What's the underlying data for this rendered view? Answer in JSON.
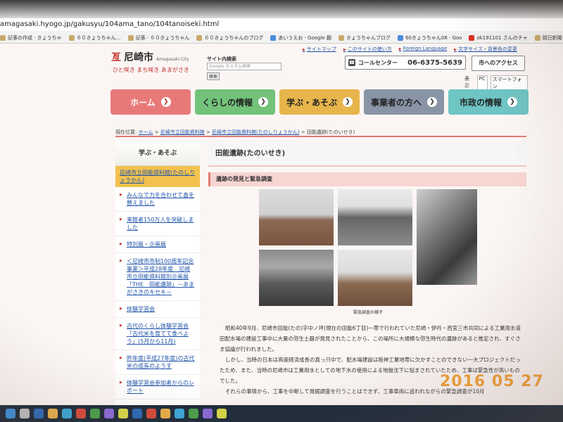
{
  "browser": {
    "url": "amagasaki.hyogo.jp/gakusyu/104ama_tano/104tanoiseki.html",
    "bookmarks": [
      "記事の作成 · きょうちゃ",
      "６０きょうちゃん…",
      "記事 · ６０きょうちゃん",
      "６０きょうちゃんのブログ",
      "あいうえお · Google 翻",
      "きょうちゃんブログ",
      "60きょうちゃん06 · Goo",
      "ok191101 さんのチャ",
      "顔日新聞デジタル"
    ]
  },
  "site": {
    "logo_mark": "亙",
    "logo_name": "尼崎市",
    "logo_en": "Amagasaki City",
    "tagline": "ひと咲き まち咲き あまがさき",
    "search_label": "サイト内検索",
    "search_placeholder": "Google カスタム検索",
    "search_button": "検索",
    "top_links": [
      "サイトマップ",
      "このサイトの使い方",
      "Foreign Language",
      "文字サイズ・背景色の変更"
    ],
    "call_center_label": "コールセンター",
    "call_center_number": "06-6375-5639",
    "access_button": "市へのアクセス",
    "display_label": "表示",
    "display_options": [
      "PC",
      "スマートフォン"
    ]
  },
  "nav": {
    "home": "ホーム",
    "life": "くらしの情報",
    "learn": "学ぶ・あそぶ",
    "business": "事業者の方へ",
    "city": "市政の情報"
  },
  "breadcrumb": {
    "prefix": "現在位置:",
    "items": [
      "ホーム",
      "尼崎市立田能資料館",
      "尼崎市立田能資料館(たのしりょうかん)",
      "田能遺跡(たのいせき)"
    ]
  },
  "sidebar": {
    "heading": "学ぶ・あそぶ",
    "current": "尼崎市立田能資料館(たのしりょうかん)",
    "items": [
      "みんなで力を合わせて畠を替えました",
      "来館者150万人を突破しました",
      "特別展・企画展",
      "＜尼崎市市制100周年記念事業＞平成28年度　尼崎市立田能資料館別企画展「THE　田能遺跡」－あまがさきのキセキ－",
      "体験学習会",
      "古代のくらし体験学習会「古代米を育てて食べよう」(5月から11月)",
      "昨年度(平成27年度)の古代米の成長のようす",
      "体験学習会参加者からのレポート"
    ]
  },
  "content": {
    "title": "田能遺跡(たのいせき)",
    "section_heading": "遺跡の発見と緊急調査",
    "photo_caption": "緊急調査の様子",
    "paragraphs": [
      "昭和40年9月、尼崎市田能(たの)字中ノ坪(現在の田能6丁目)一帯で行われていた尼崎・伊丹・西宮三市共同による工業用水道田配水場の建設工事中に大量の弥生土器が発見されたことから、この場所に大規模な弥生時代の遺跡があると推定され、すぐさま協議が行われました。",
      "しかし、当時の日本は高度経済成長の真っ只中で、配水場建設は阪神工業地帯に欠かすことのできない一大プロジェクトだったため、また、当時の尼崎市は工業用水としての地下水の使用による地盤沈下に悩まされていたため、工事は緊急性が高いものでした。",
      "それらの事情から、工事を中断して発掘調査を行うことはできず、工事車両に追われながらの緊急調査が10月"
    ]
  },
  "photo_timestamp": "2016 05 27"
}
